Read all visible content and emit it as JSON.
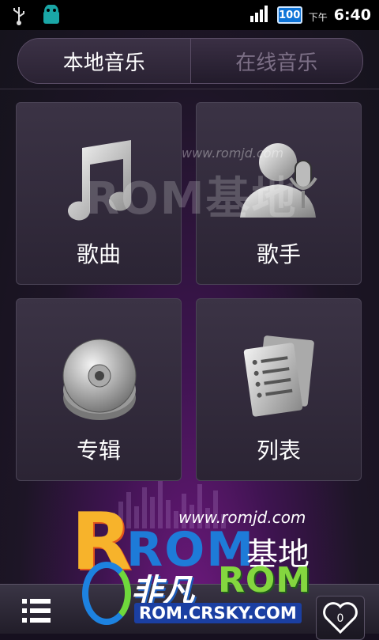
{
  "status_bar": {
    "battery": "100",
    "ampm": "下午",
    "time": "6:40"
  },
  "tabs": [
    {
      "label": "本地音乐",
      "active": true
    },
    {
      "label": "在线音乐",
      "active": false
    }
  ],
  "tiles": {
    "songs": "歌曲",
    "artists": "歌手",
    "albums": "专辑",
    "playlists": "列表"
  },
  "watermark": {
    "url_top": "www.romjd.com",
    "text_top": "ROM基地",
    "url_bottom": "www.romjd.com",
    "logo_rom": "ROM",
    "logo_cn": "基地"
  },
  "bottom_bar": {
    "favorite_count": "0"
  },
  "feifan": {
    "cn": "非凡",
    "rom": "ROM",
    "url": "ROM.CRSKY.COM"
  },
  "colors": {
    "battery": "#0e74d8",
    "accent_purple": "#7a1a8a",
    "feifan_green": "#84d63f",
    "feifan_blue": "#1b3fa2"
  }
}
